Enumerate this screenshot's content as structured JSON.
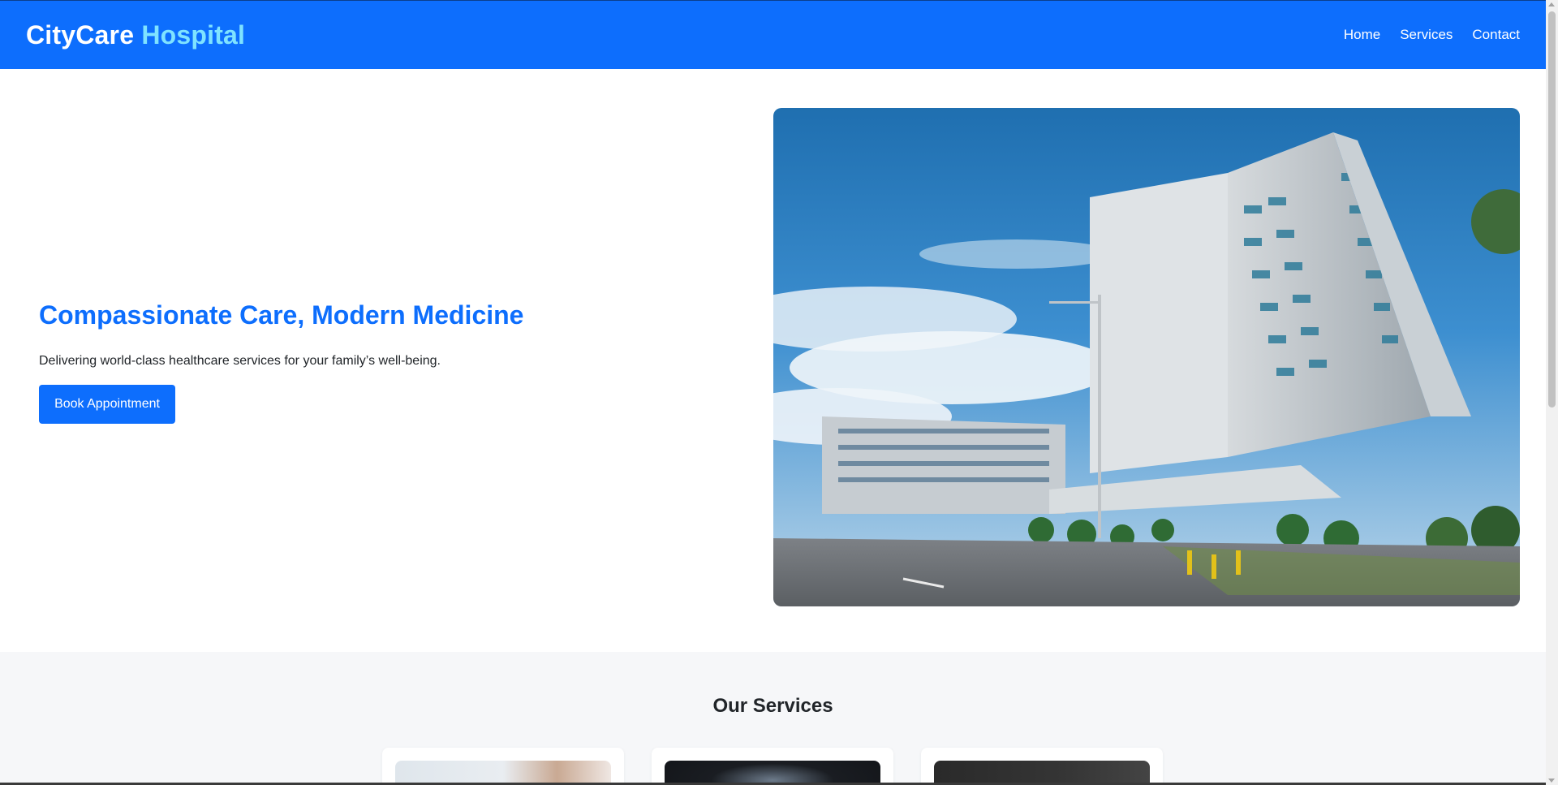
{
  "header": {
    "brand_primary": "CityCare",
    "brand_accent": "Hospital",
    "nav": [
      "Home",
      "Services",
      "Contact"
    ]
  },
  "hero": {
    "title": "Compassionate Care, Modern Medicine",
    "subtitle": "Delivering world-class healthcare services for your family’s well-being.",
    "cta_label": "Book Appointment",
    "image_alt": "hospital-building-photo"
  },
  "services": {
    "title": "Our Services"
  },
  "colors": {
    "primary": "#0d6efd",
    "brand_accent": "#7fe3ff",
    "section_bg": "#f6f7f9"
  }
}
